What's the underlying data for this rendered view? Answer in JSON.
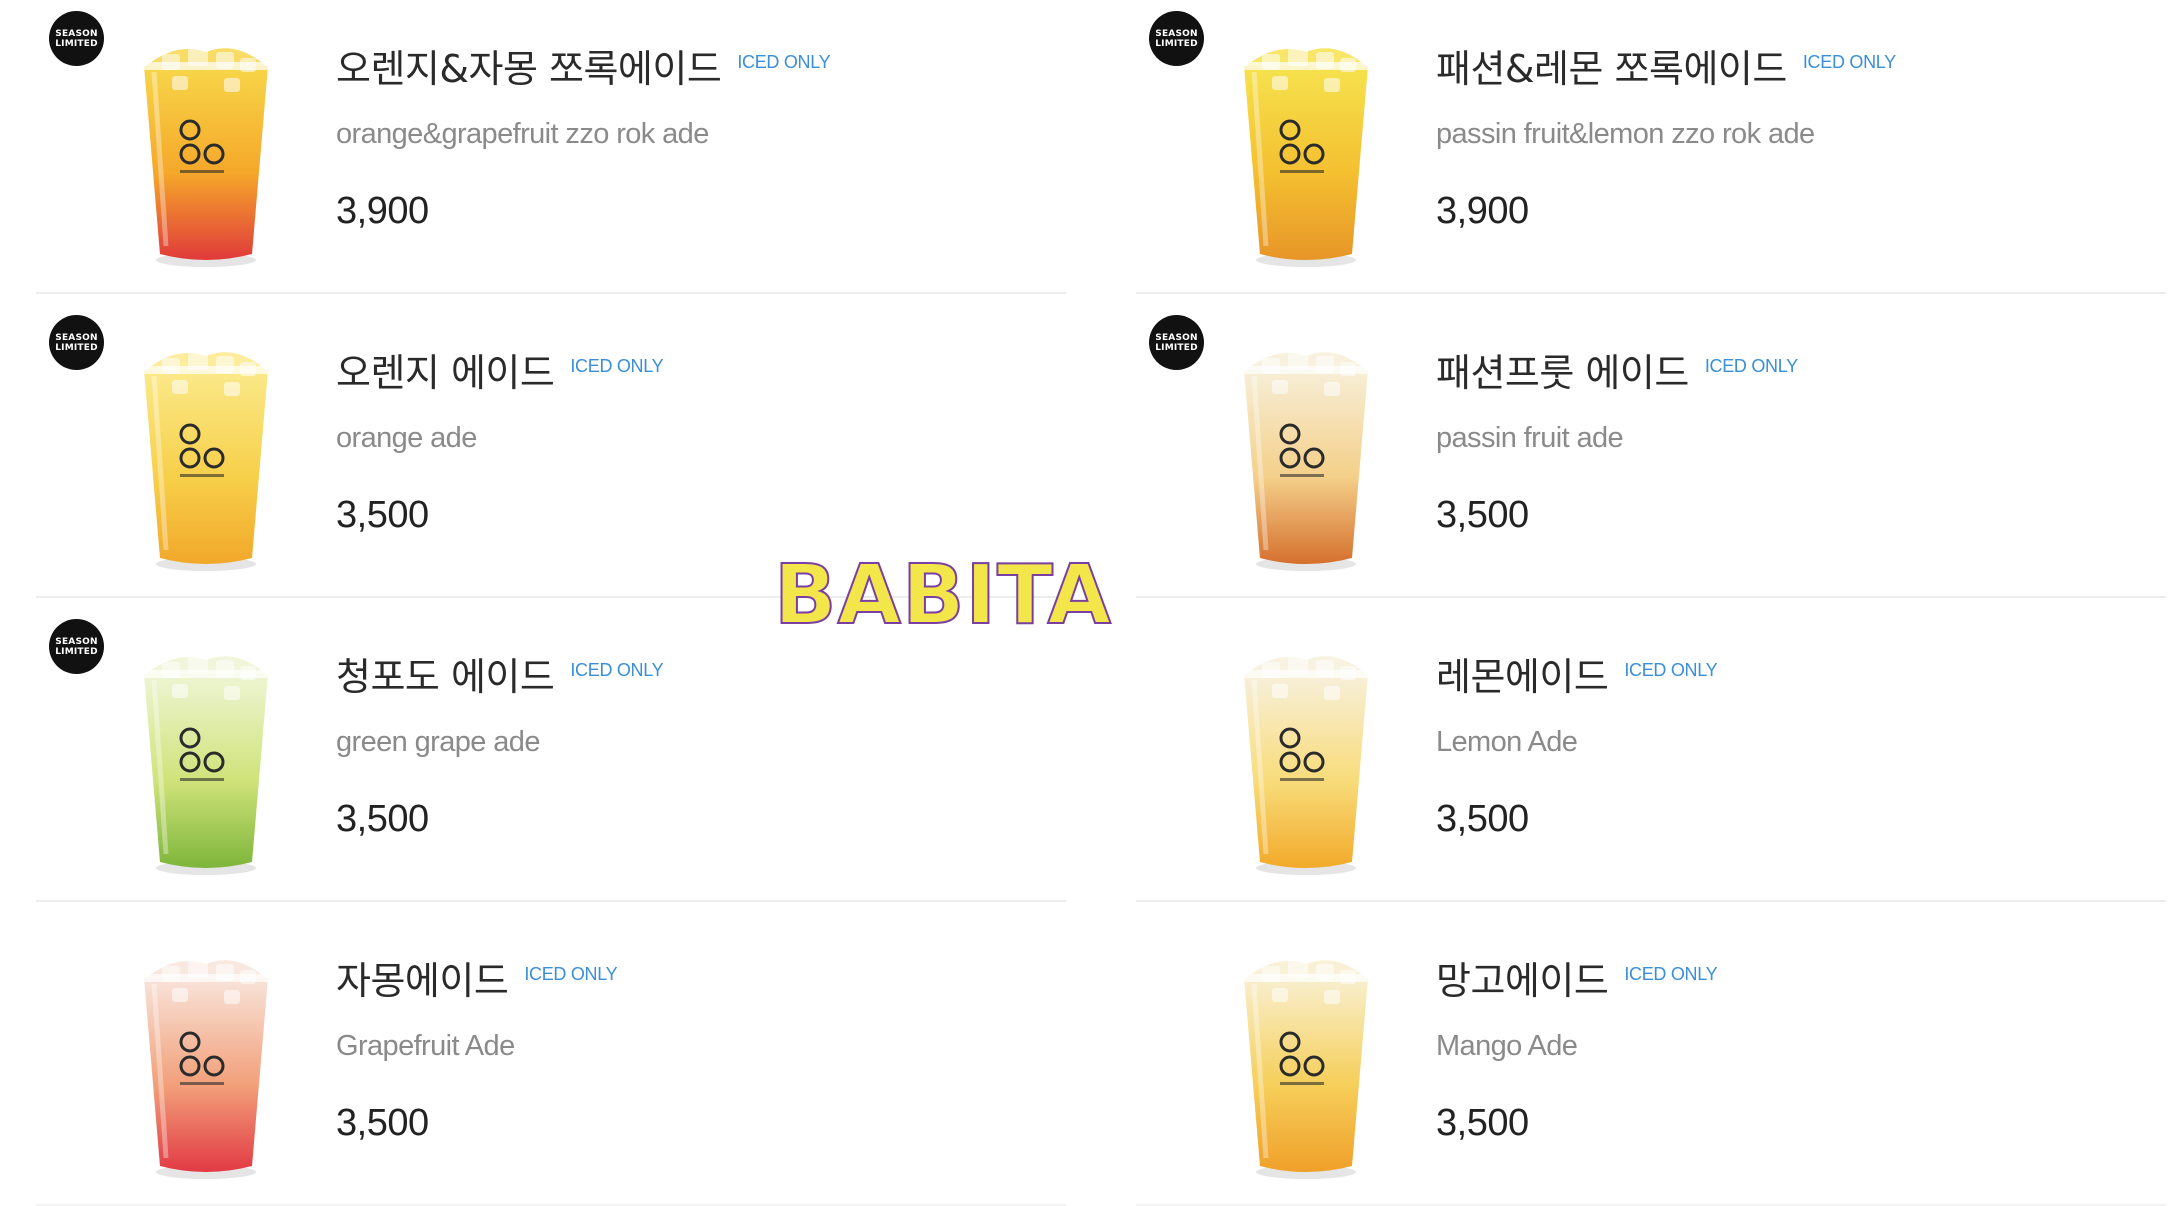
{
  "menu": {
    "items": [
      {
        "name_ko": "오렌지&자몽 쪼록에이드",
        "name_en": "orange&grapefruit zzo rok ade",
        "price": "3,900",
        "iced_label": "ICED ONLY",
        "season_limited": true,
        "drink_colors": [
          "#f7d64a",
          "#f5a82a",
          "#e03a3a"
        ]
      },
      {
        "name_ko": "패션&레몬 쪼록에이드",
        "name_en": "passin fruit&lemon zzo rok ade",
        "price": "3,900",
        "iced_label": "ICED ONLY",
        "season_limited": true,
        "drink_colors": [
          "#f6e24e",
          "#f4c030",
          "#e79528"
        ]
      },
      {
        "name_ko": "오렌지 에이드",
        "name_en": "orange ade",
        "price": "3,500",
        "iced_label": "ICED ONLY",
        "season_limited": true,
        "drink_colors": [
          "#fbe98a",
          "#f7d04a",
          "#f2a82a"
        ]
      },
      {
        "name_ko": "패션프룻 에이드",
        "name_en": "passin fruit ade",
        "price": "3,500",
        "iced_label": "ICED ONLY",
        "season_limited": true,
        "drink_colors": [
          "#f7efd8",
          "#f4d08a",
          "#d6702e"
        ]
      },
      {
        "name_ko": "청포도 에이드",
        "name_en": "green grape ade",
        "price": "3,500",
        "iced_label": "ICED ONLY",
        "season_limited": true,
        "drink_colors": [
          "#eef5d4",
          "#cfe37a",
          "#7eb53a"
        ]
      },
      {
        "name_ko": "레몬에이드",
        "name_en": "Lemon Ade",
        "price": "3,500",
        "iced_label": "ICED ONLY",
        "season_limited": false,
        "drink_colors": [
          "#f7f0dc",
          "#f8dc7a",
          "#f2aa2a"
        ]
      },
      {
        "name_ko": "자몽에이드",
        "name_en": "Grapefruit Ade",
        "price": "3,500",
        "iced_label": "ICED ONLY",
        "season_limited": false,
        "drink_colors": [
          "#f8e4da",
          "#f2a07a",
          "#e23a44"
        ]
      },
      {
        "name_ko": "망고에이드",
        "name_en": "Mango Ade",
        "price": "3,500",
        "iced_label": "ICED ONLY",
        "season_limited": false,
        "drink_colors": [
          "#f8efcf",
          "#f6cf5a",
          "#f0a02a"
        ]
      }
    ]
  },
  "badge": {
    "line1": "SEASON",
    "line2": "LIMITED"
  },
  "watermark": "BABITA",
  "colors": {
    "iced_label": "#3a8fd8",
    "divider": "#ececec",
    "badge": "#111111"
  }
}
